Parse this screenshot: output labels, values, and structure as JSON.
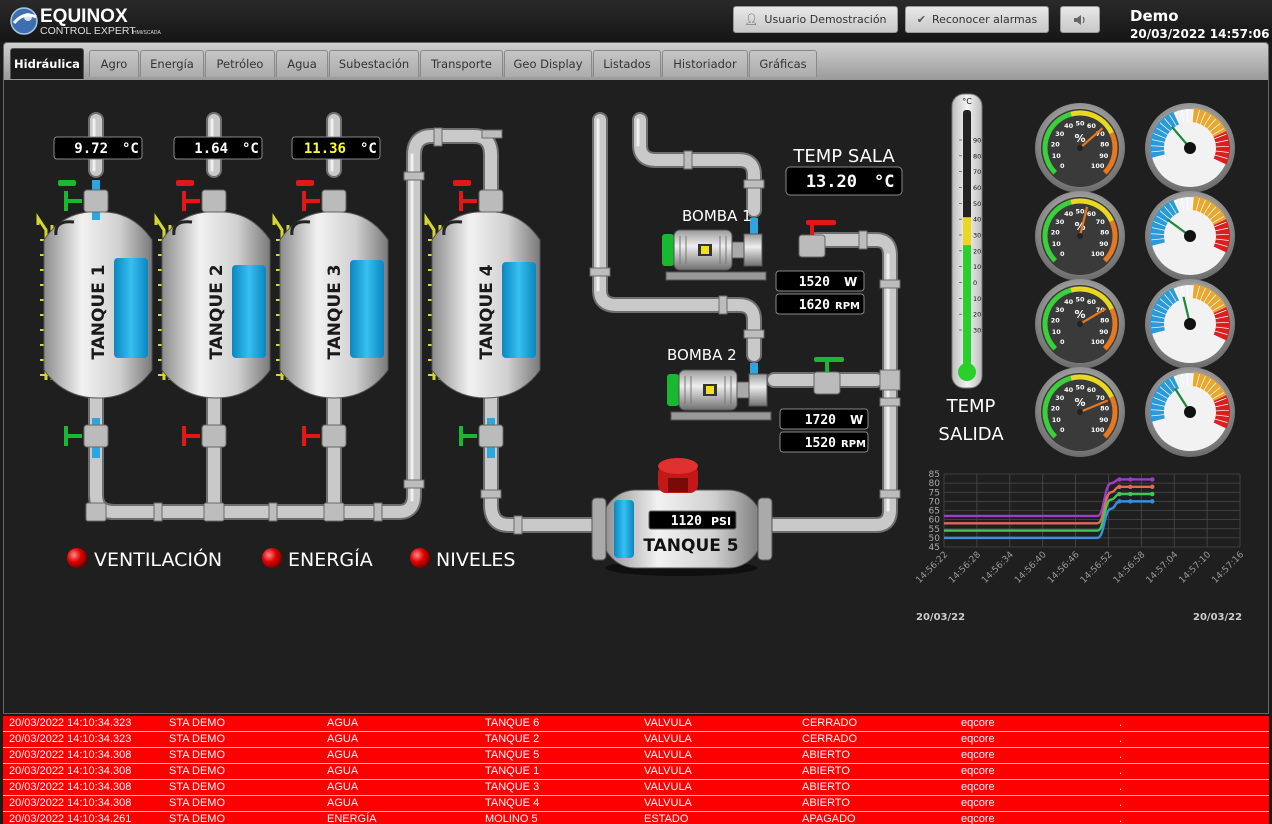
{
  "header": {
    "logo_title": "EQUINOX",
    "logo_subtitle": "CONTROL EXPERT",
    "logo_tag": "HMI/SCADA",
    "user_button": "Usuario Demostración",
    "ack_button": "Reconocer alarmas",
    "user_name": "Demo",
    "datetime": "20/03/2022 14:57:06"
  },
  "tabs": [
    {
      "label": "Hidráulica",
      "active": true
    },
    {
      "label": "Agro"
    },
    {
      "label": "Energía"
    },
    {
      "label": "Petróleo"
    },
    {
      "label": "Agua"
    },
    {
      "label": "Subestación"
    },
    {
      "label": "Transporte"
    },
    {
      "label": "Geo Display"
    },
    {
      "label": "Listados"
    },
    {
      "label": "Historiador"
    },
    {
      "label": "Gráficas"
    }
  ],
  "tanks": [
    {
      "name": "TANQUE 1",
      "temp": "9.72",
      "unit": "°C",
      "top_valve": "open",
      "bottom_valve": "open"
    },
    {
      "name": "TANQUE 2",
      "temp": "1.64",
      "unit": "°C",
      "top_valve": "closed",
      "bottom_valve": "closed"
    },
    {
      "name": "TANQUE 3",
      "temp": "11.36",
      "unit": "°C",
      "top_valve": "closed",
      "bottom_valve": "closed"
    },
    {
      "name": "TANQUE 4",
      "top_valve": "closed",
      "bottom_valve": "open"
    }
  ],
  "tank5": {
    "name": "TANQUE 5",
    "pressure": "1120",
    "unit": "PSI"
  },
  "pumps": [
    {
      "name": "BOMBA 1",
      "power": "1520",
      "power_unit": "W",
      "speed": "1620",
      "speed_unit": "RPM"
    },
    {
      "name": "BOMBA 2",
      "power": "1720",
      "power_unit": "W",
      "speed": "1520",
      "speed_unit": "RPM"
    }
  ],
  "temp_sala": {
    "label": "TEMP SALA",
    "value": "13.20",
    "unit": "°C"
  },
  "temp_salida": {
    "label_line1": "TEMP",
    "label_line2": "SALIDA",
    "unit": "°C",
    "scale_ticks": [
      "90",
      "80",
      "70",
      "60",
      "50",
      "40",
      "30",
      "20",
      "10",
      "0",
      "10",
      "20",
      "30"
    ],
    "level_fraction": 0.6
  },
  "indicators": [
    {
      "label": "VENTILACIÓN",
      "color": "#e00000"
    },
    {
      "label": "ENERGÍA",
      "color": "#e00000"
    },
    {
      "label": "NIVELES",
      "color": "#e00000"
    }
  ],
  "gauges_pct": [
    {
      "symbol": "%",
      "ticks": [
        "0",
        "10",
        "20",
        "30",
        "40",
        "50",
        "60",
        "70",
        "80",
        "90",
        "100"
      ],
      "value": 68
    },
    {
      "symbol": "%",
      "ticks": [
        "0",
        "10",
        "20",
        "30",
        "40",
        "50",
        "60",
        "70",
        "80",
        "90",
        "100"
      ],
      "value": 55
    },
    {
      "symbol": "%",
      "ticks": [
        "0",
        "10",
        "20",
        "30",
        "40",
        "50",
        "60",
        "70",
        "80",
        "90",
        "100"
      ],
      "value": 72
    },
    {
      "symbol": "%",
      "ticks": [
        "0",
        "10",
        "20",
        "30",
        "40",
        "50",
        "60",
        "70",
        "80",
        "90",
        "100"
      ],
      "value": 75
    }
  ],
  "gauges_temp": [
    {
      "value": 35
    },
    {
      "value": 30
    },
    {
      "value": 45
    },
    {
      "value": 38
    }
  ],
  "chart_data": {
    "type": "line",
    "x": [
      "14:56:22",
      "14:56:28",
      "14:56:34",
      "14:56:40",
      "14:56:46",
      "14:56:52",
      "14:56:58",
      "14:57:04",
      "14:57:10",
      "14:57:16"
    ],
    "date_left": "20/03/22",
    "date_right": "20/03/22",
    "ylim": [
      45,
      85
    ],
    "yticks": [
      "85",
      "80",
      "75",
      "70",
      "65",
      "60",
      "55",
      "50",
      "45"
    ],
    "grid": true,
    "series": [
      {
        "color": "#9b3fc8",
        "t": [
          0,
          28,
          30.5,
          32,
          34,
          38
        ],
        "values": [
          62,
          62,
          80,
          82,
          82,
          82
        ]
      },
      {
        "color": "#e06a5a",
        "t": [
          0,
          28,
          30.5,
          32,
          34,
          38
        ],
        "values": [
          58,
          58,
          75,
          78,
          78,
          78
        ]
      },
      {
        "color": "#3fc85a",
        "t": [
          0,
          28,
          30.5,
          32,
          34,
          38
        ],
        "values": [
          54,
          54,
          71,
          74,
          74,
          74
        ]
      },
      {
        "color": "#3a8fd8",
        "t": [
          0,
          28,
          30.5,
          32,
          34,
          38
        ],
        "values": [
          50,
          50,
          66,
          70,
          70,
          70
        ]
      }
    ]
  },
  "alarms": [
    [
      "20/03/2022 14:10:34.323",
      "STA DEMO",
      "AGUA",
      "TANQUE 6",
      "VALVULA",
      "CERRADO",
      "eqcore",
      "."
    ],
    [
      "20/03/2022 14:10:34.323",
      "STA DEMO",
      "AGUA",
      "TANQUE 2",
      "VALVULA",
      "CERRADO",
      "eqcore",
      "."
    ],
    [
      "20/03/2022 14:10:34.308",
      "STA DEMO",
      "AGUA",
      "TANQUE 5",
      "VALVULA",
      "ABIERTO",
      "eqcore",
      "."
    ],
    [
      "20/03/2022 14:10:34.308",
      "STA DEMO",
      "AGUA",
      "TANQUE 1",
      "VALVULA",
      "ABIERTO",
      "eqcore",
      "."
    ],
    [
      "20/03/2022 14:10:34.308",
      "STA DEMO",
      "AGUA",
      "TANQUE 3",
      "VALVULA",
      "ABIERTO",
      "eqcore",
      "."
    ],
    [
      "20/03/2022 14:10:34.308",
      "STA DEMO",
      "AGUA",
      "TANQUE 4",
      "VALVULA",
      "ABIERTO",
      "eqcore",
      "."
    ],
    [
      "20/03/2022 14:10:34.261",
      "STA DEMO",
      "ENERGÍA",
      "MOLINO 5",
      "ESTADO",
      "APAGADO",
      "eqcore",
      "."
    ]
  ]
}
